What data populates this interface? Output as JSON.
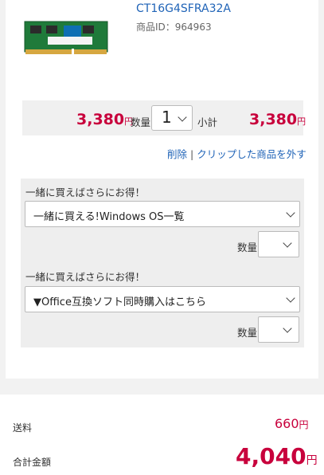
{
  "product": {
    "name": "CT16G4SFRA32A",
    "id_text": "商品ID：964963",
    "price": "3,380",
    "yen": "円",
    "qty_label": "数量",
    "qty_value": "1",
    "subtotal_label": "小計",
    "subtotal": "3,380"
  },
  "actions": {
    "delete": "削除",
    "separator": "|",
    "clip": "クリップした商品を外す"
  },
  "bundles": [
    {
      "label": "一緒に買えばさらにお得！",
      "selected": "一緒に買える!Windows OS一覧",
      "qty_label": "数量"
    },
    {
      "label": "一緒に買えばさらにお得！",
      "selected": "▼Office互換ソフト同時購入はこちら",
      "qty_label": "数量"
    }
  ],
  "summary": {
    "shipping_label": "送料",
    "shipping_value": "660",
    "total_label": "合計金額",
    "total_value": "4,040",
    "yen": "円"
  },
  "colors": {
    "price_red": "#c8003c",
    "link_blue": "#1f63b7",
    "module_green": "#1f7a3a"
  },
  "icons": [
    "memory-module-image",
    "chevron-down-icon"
  ]
}
